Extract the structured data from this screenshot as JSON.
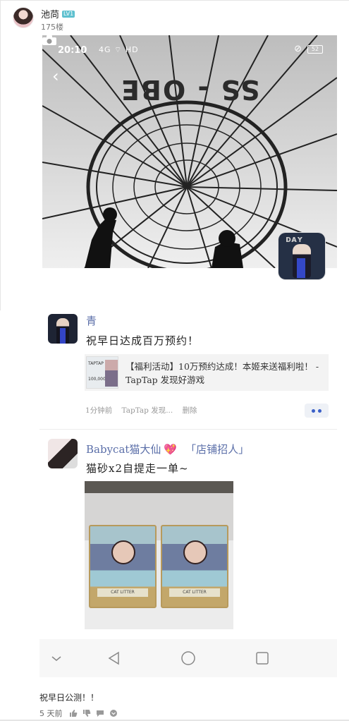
{
  "post": {
    "username": "池苘",
    "level": "LV1",
    "floor": "175楼",
    "footer_text": "祝早日公测！！",
    "footer_time": "5 天前"
  },
  "screenshot": {
    "status_time": "20:10",
    "status_signal": "4G  ⌔  HD",
    "status_battery": "52",
    "balloon_text": "SS - OBE"
  },
  "comment1": {
    "name": "青",
    "text": "祝早日达成百万预约！",
    "link_text": "【福利活动】10万预约达成！本姬来送福利啦！ - TapTap 发现好游戏",
    "link_thumb_t1": "TAPTAP",
    "link_thumb_t2": "100,000",
    "time": "1分钟前",
    "source": "TapTap 发现...",
    "delete": "删除"
  },
  "comment2": {
    "name": "Babycat猫大仙",
    "heart": "💖",
    "shop": "「店铺招人」",
    "text": "猫砂x2自提走一单~",
    "pack_label": "CAT LITTER"
  },
  "colors": {
    "accent_blue": "#3a5fc8",
    "name_blue": "#5a6ea8",
    "level_badge": "#5ec0cf"
  },
  "icons": {
    "nav": [
      "chevron-down-icon",
      "back-triangle-icon",
      "home-circle-icon",
      "recent-square-icon"
    ],
    "footer": [
      "thumbs-up-icon",
      "thumbs-down-icon",
      "comment-icon",
      "more-icon"
    ]
  }
}
